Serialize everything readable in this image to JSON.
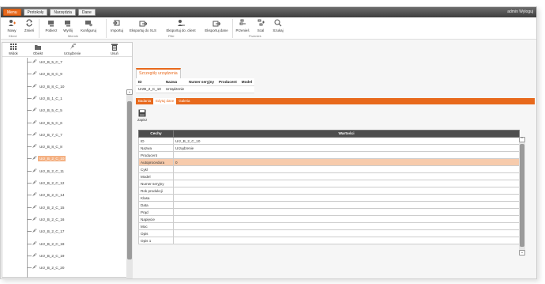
{
  "menubar": {
    "tabs": [
      "Menu",
      "Protokoły",
      "Narzędzia",
      "Dane"
    ],
    "user": "admin",
    "logout": "Wyloguj"
  },
  "ribbon": {
    "buttons": [
      "Nowy",
      "Zmień",
      "Pobierz",
      "Wyślij",
      "Konfiguruj",
      "Importuj",
      "Eksportuj do XLS",
      "Eksportuj do .client",
      "Eksportuj dane",
      "Przenieś",
      "Scal",
      "Szukaj"
    ],
    "groups": [
      "Klient",
      "Miernik",
      "Pliki",
      "Przenieś"
    ]
  },
  "left_toolbar": {
    "buttons": [
      "Widok",
      "Obiekt",
      "Urządzenie",
      "Usuń"
    ]
  },
  "tree": {
    "items": [
      "Urz_B_5_C_7",
      "Urz_B_8_C_9",
      "Urz_B_8_C_10",
      "Urz_B_1_C_1",
      "Urz_B_5_C_5",
      "Urz_B_5_C_6",
      "Urz_B_7_C_7",
      "Urz_B_8_C_8",
      "Urz_B_2_C_10",
      "Urz_B_2_C_11",
      "Urz_B_2_C_12",
      "Urz_B_2_C_14",
      "Urz_B_2_C_15",
      "Urz_B_2_C_16",
      "Urz_B_2_C_17",
      "Urz_B_2_C_18",
      "Urz_B_2_C_19",
      "Urz_B_2_C_20"
    ],
    "selected": "Urz_B_2_C_10"
  },
  "detail": {
    "title": "Szczegóły urządzenia",
    "columns": [
      "ID",
      "Nazwa",
      "Numer seryjny",
      "Producent",
      "Model"
    ],
    "row": [
      "UrzB_2_C_10",
      "Urządzenie",
      "",
      "",
      ""
    ]
  },
  "tabs": [
    "Badania",
    "Edytuj dane",
    "Galeria"
  ],
  "save_label": "Zapisz",
  "props": {
    "headers": [
      "Cechy",
      "Wartości"
    ],
    "rows": [
      [
        "ID",
        "Urz_B_2_C_10"
      ],
      [
        "Nazwa",
        "Urządzenie"
      ],
      [
        "Producent",
        ""
      ],
      [
        "Autoprocedura",
        "0"
      ],
      [
        "Cykl",
        ""
      ],
      [
        "Model",
        ""
      ],
      [
        "Numer seryjny",
        ""
      ],
      [
        "Rok produkcji",
        ""
      ],
      [
        "Klasa",
        ""
      ],
      [
        "Data",
        ""
      ],
      [
        "Prąd",
        ""
      ],
      [
        "Napięcie",
        ""
      ],
      [
        "Moc",
        ""
      ],
      [
        "Opis",
        ""
      ],
      [
        "Opis 1",
        ""
      ]
    ]
  },
  "colors": {
    "accent": "#e8691c",
    "highlight": "#f7cbac",
    "header": "#4d4d4d"
  }
}
